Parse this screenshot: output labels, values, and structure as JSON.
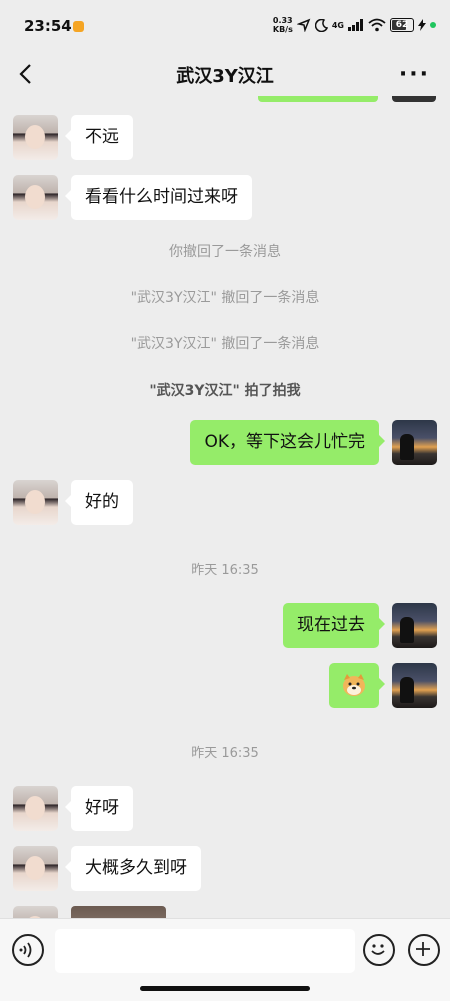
{
  "status_bar": {
    "time": "23:54",
    "net_speed_value": "0.33",
    "net_speed_unit": "KB/s",
    "network": "4G",
    "battery": "62"
  },
  "nav": {
    "title": "武汉3Y汉江",
    "back_icon": "chevron-left-icon",
    "more_label": "···"
  },
  "messages": [
    {
      "type": "text",
      "side": "left",
      "text": "不远"
    },
    {
      "type": "text",
      "side": "left",
      "text": "看看什么时间过来呀"
    },
    {
      "type": "system",
      "text": "你撤回了一条消息"
    },
    {
      "type": "system",
      "text": "\"武汉3Y汉江\" 撤回了一条消息"
    },
    {
      "type": "system",
      "text": "\"武汉3Y汉江\" 撤回了一条消息"
    },
    {
      "type": "system_bold",
      "text": "\"武汉3Y汉江\" 拍了拍我"
    },
    {
      "type": "text",
      "side": "right",
      "text": "OK，等下这会儿忙完"
    },
    {
      "type": "text",
      "side": "left",
      "text": "好的"
    },
    {
      "type": "time",
      "text": "昨天 16:35"
    },
    {
      "type": "text",
      "side": "right",
      "text": "现在过去"
    },
    {
      "type": "emoji",
      "side": "right",
      "icon": "doge-emoji-icon"
    },
    {
      "type": "time",
      "text": "昨天 16:35"
    },
    {
      "type": "text",
      "side": "left",
      "text": "好呀"
    },
    {
      "type": "text",
      "side": "left",
      "text": "大概多久到呀"
    },
    {
      "type": "image",
      "side": "left"
    }
  ],
  "input_bar": {
    "voice_icon": "voice-icon",
    "emoji_icon": "smiley-icon",
    "plus_icon": "plus-icon",
    "placeholder": ""
  },
  "colors": {
    "background": "#ededed",
    "bubble_right": "#95ec69",
    "bubble_left": "#ffffff",
    "system_text": "#9a9a9a"
  }
}
